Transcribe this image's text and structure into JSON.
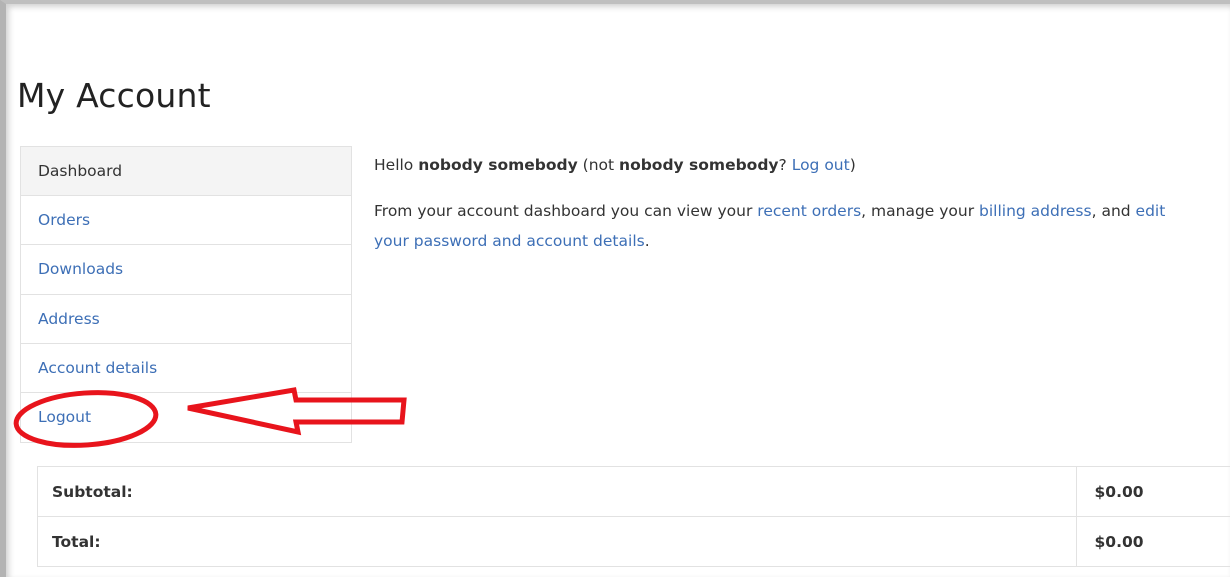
{
  "page": {
    "title": "My Account"
  },
  "sidebar": {
    "items": [
      {
        "label": "Dashboard"
      },
      {
        "label": "Orders"
      },
      {
        "label": "Downloads"
      },
      {
        "label": "Address"
      },
      {
        "label": "Account details"
      },
      {
        "label": "Logout"
      }
    ]
  },
  "content": {
    "greeting": {
      "hello": "Hello ",
      "username": "nobody somebody",
      "paren_open": " (not ",
      "username_repeat": "nobody somebody",
      "question": "? ",
      "logout_link": "Log out",
      "paren_close": ")"
    },
    "description": {
      "part1": "From your account dashboard you can view your ",
      "link_recent_orders": "recent orders",
      "part2": ", manage your ",
      "link_billing_address": "billing address",
      "part3": ", and ",
      "link_edit_account": "edit your password and account details",
      "part4": "."
    }
  },
  "totals": {
    "rows": [
      {
        "label": "Subtotal:",
        "value": "$0.00"
      },
      {
        "label": "Total:",
        "value": "$0.00"
      }
    ]
  },
  "colors": {
    "link": "#3d6fb6",
    "text": "#333333",
    "annotation": "#e8141c",
    "border": "#e2e2e2",
    "active_bg": "#f4f4f4"
  }
}
